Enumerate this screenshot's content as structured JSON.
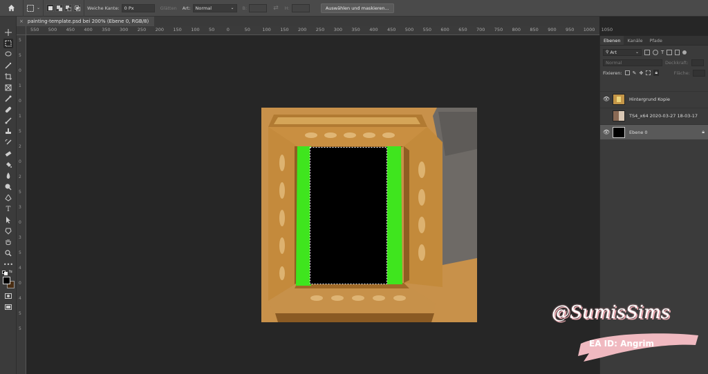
{
  "options_bar": {
    "soft_edge_label": "Weiche Kante:",
    "soft_edge_value": "0 Px",
    "smooth_label": "Glätten",
    "style_label": "Art:",
    "style_value": "Normal",
    "width_label": "B:",
    "height_label": "H:",
    "select_mask_label": "Auswählen und maskieren..."
  },
  "document_tab": {
    "close_glyph": "×",
    "title": "painting-template.psd bei 200% (Ebene 0, RGB/8)"
  },
  "ruler_top": [
    "550",
    "500",
    "450",
    "400",
    "350",
    "300",
    "250",
    "200",
    "150",
    "100",
    "50",
    "0",
    "50",
    "100",
    "150",
    "200",
    "250",
    "300",
    "350",
    "400",
    "450",
    "500",
    "550",
    "600",
    "650",
    "700",
    "750",
    "800",
    "850",
    "900",
    "950",
    "1000",
    "1050"
  ],
  "ruler_left": [
    "5",
    "5",
    "0",
    "1",
    "0",
    "1",
    "5",
    "2",
    "0",
    "2",
    "5",
    "3",
    "0",
    "3",
    "5",
    "4",
    "0",
    "4",
    "5",
    "5"
  ],
  "panels": {
    "tabs": [
      "Ebenen",
      "Kanäle",
      "Pfade"
    ],
    "filter_label": "Art",
    "blend_mode": "Normal",
    "opacity_label": "Deckkraft:",
    "lock_label": "Fixieren:",
    "fill_label": "Fläche:",
    "layers": [
      {
        "name": "Hintergrund Kopie",
        "visible": true,
        "selected": false
      },
      {
        "name": "TS4_x64 2020-03-27 18-03-17",
        "visible": false,
        "selected": false
      },
      {
        "name": "Ebene 0",
        "visible": true,
        "selected": true
      }
    ]
  },
  "watermark": {
    "name": "@SumisSims",
    "ea_id": "EA ID: Angrim"
  },
  "colors": {
    "selection_green": "#3fe51e",
    "frame_gold": "#c8913f",
    "panel_bg": "#3b3b3b",
    "canvas_bg": "#262626"
  }
}
